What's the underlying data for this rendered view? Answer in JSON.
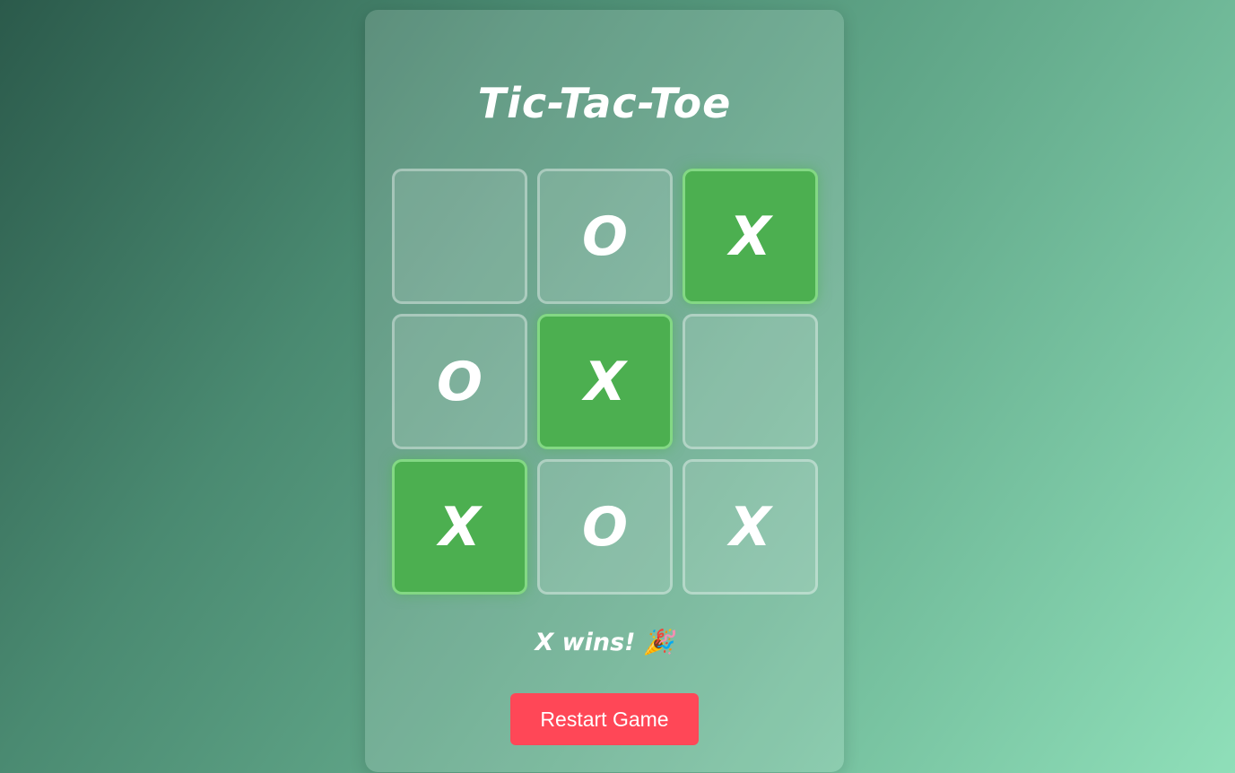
{
  "title": "Tic-Tac-Toe",
  "board": {
    "cells": [
      {
        "mark": "",
        "winning": false
      },
      {
        "mark": "O",
        "winning": false
      },
      {
        "mark": "X",
        "winning": true
      },
      {
        "mark": "O",
        "winning": false
      },
      {
        "mark": "X",
        "winning": true
      },
      {
        "mark": "",
        "winning": false
      },
      {
        "mark": "X",
        "winning": true
      },
      {
        "mark": "O",
        "winning": false
      },
      {
        "mark": "X",
        "winning": false
      }
    ]
  },
  "status": "X wins! 🎉",
  "restart_label": "Restart Game",
  "colors": {
    "win_cell": "#4caf50",
    "restart_button": "#ff4757",
    "text": "#ffffff"
  }
}
